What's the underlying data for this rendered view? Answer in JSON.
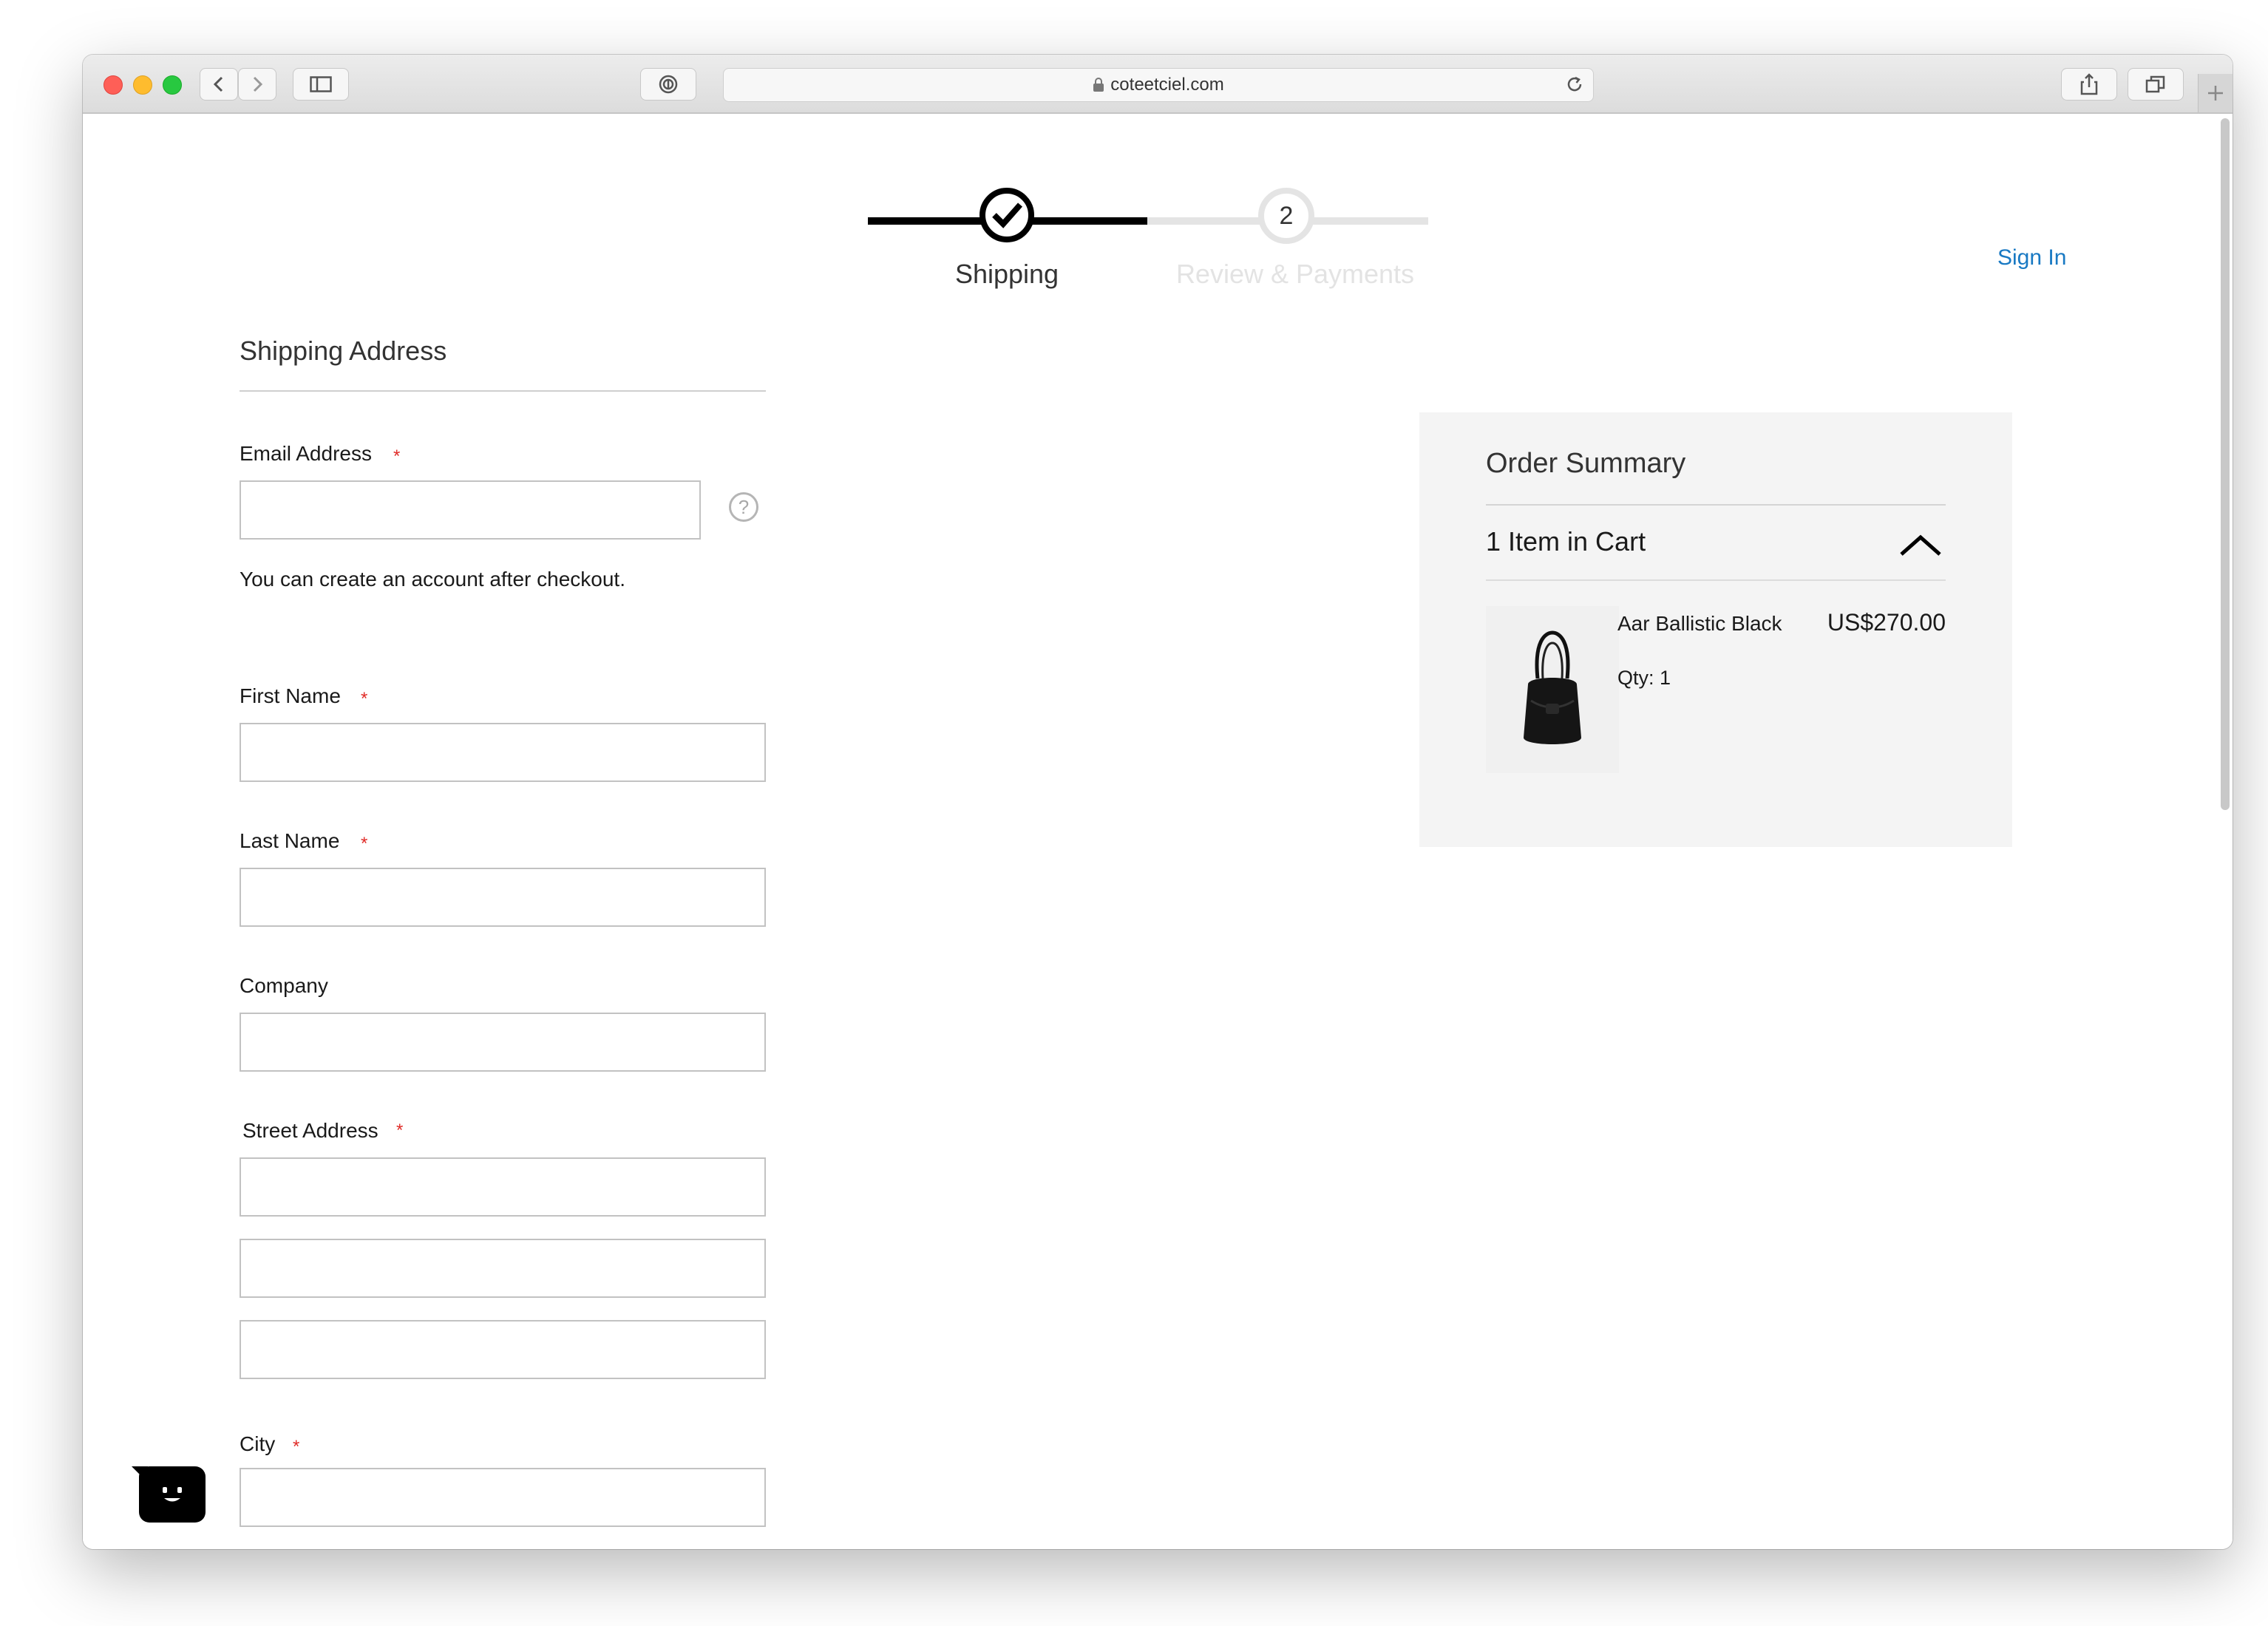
{
  "browser": {
    "url": "coteetciel.com",
    "icons": {
      "back": "chevron-left-icon",
      "forward": "chevron-right-icon",
      "sidebar": "sidebar-icon",
      "privacy": "password-manager-icon",
      "lock": "lock-icon",
      "reload": "reload-icon",
      "share": "share-icon",
      "tabs": "tabs-icon",
      "new_tab": "plus-icon"
    }
  },
  "header": {
    "sign_in": "Sign In"
  },
  "progress": {
    "steps": [
      {
        "label": "Shipping",
        "status": "complete",
        "icon": "checkmark-icon"
      },
      {
        "label": "Review & Payments",
        "number": "2",
        "status": "upcoming"
      }
    ],
    "colors": {
      "done": "#000000",
      "todo": "#e4e4e4",
      "upcoming_text": "#e3e3e3"
    }
  },
  "form": {
    "title": "Shipping Address",
    "required_mark": "*",
    "email": {
      "label": "Email Address",
      "value": "",
      "help_icon": "help-question-icon"
    },
    "account_note": "You can create an account after checkout.",
    "first_name": {
      "label": "First Name",
      "value": ""
    },
    "last_name": {
      "label": "Last Name",
      "value": ""
    },
    "company": {
      "label": "Company",
      "value": ""
    },
    "street": {
      "label": "Street Address",
      "lines": [
        "",
        "",
        ""
      ]
    },
    "city": {
      "label": "City",
      "value": ""
    }
  },
  "summary": {
    "title": "Order Summary",
    "cart_count": "1 Item in Cart",
    "expanded": true,
    "items": [
      {
        "name": "Aar Ballistic Black",
        "price": "US$270.00",
        "qty": "Qty: 1",
        "image": "black-backpack-image"
      }
    ]
  },
  "chat_widget": {
    "icon": "chat-face-icon"
  },
  "colors": {
    "link": "#1979c3",
    "required": "#e02b27",
    "summary_bg": "#f4f4f4"
  }
}
